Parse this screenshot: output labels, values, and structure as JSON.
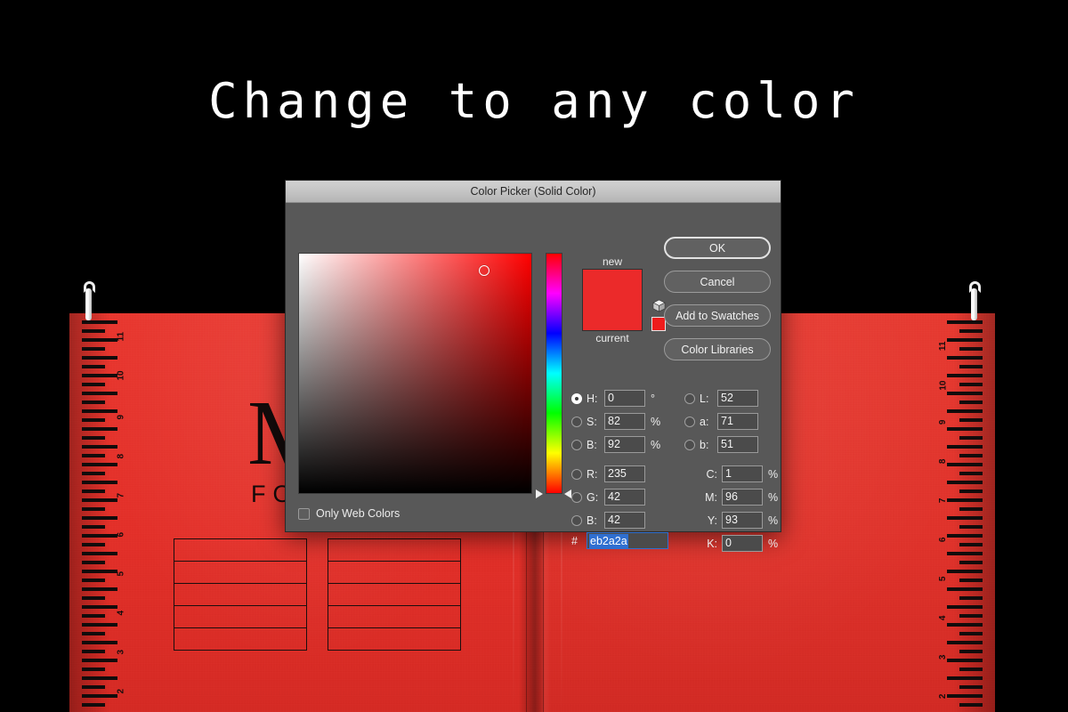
{
  "headline": "Change to any color",
  "notebook": {
    "brand_primary": "Mo",
    "brand_secondary": "FO",
    "cover_color": "#e8372f",
    "ruler_numbers_left": [
      "11",
      "10",
      "9",
      "8",
      "7",
      "6",
      "5",
      "4",
      "3",
      "2"
    ],
    "ruler_numbers_right": [
      "11",
      "10",
      "9",
      "8",
      "7",
      "6",
      "5",
      "4",
      "3",
      "2"
    ],
    "table_rows": 5
  },
  "dialog": {
    "title": "Color Picker (Solid Color)",
    "buttons": [
      {
        "label": "OK",
        "primary": true
      },
      {
        "label": "Cancel",
        "primary": false
      },
      {
        "label": "Add to Swatches",
        "primary": false
      },
      {
        "label": "Color Libraries",
        "primary": false
      }
    ],
    "preview": {
      "new_label": "new",
      "current_label": "current",
      "color": "#eb2a2a"
    },
    "gamut": {
      "cube_icon": "out-of-gamut-cube-icon",
      "websafe_chip_color": "#ee1c1c"
    },
    "only_web_colors": {
      "label": "Only Web Colors",
      "checked": false
    },
    "hsb": [
      {
        "key": "H",
        "label": "H:",
        "value": "0",
        "unit": "°",
        "selected": true
      },
      {
        "key": "S",
        "label": "S:",
        "value": "82",
        "unit": "%",
        "selected": false
      },
      {
        "key": "B",
        "label": "B:",
        "value": "92",
        "unit": "%",
        "selected": false
      }
    ],
    "lab": [
      {
        "key": "L",
        "label": "L:",
        "value": "52",
        "unit": "",
        "selected": false
      },
      {
        "key": "a",
        "label": "a:",
        "value": "71",
        "unit": "",
        "selected": false
      },
      {
        "key": "b",
        "label": "b:",
        "value": "51",
        "unit": "",
        "selected": false
      }
    ],
    "rgb": [
      {
        "key": "R",
        "label": "R:",
        "value": "235",
        "unit": "",
        "selected": false
      },
      {
        "key": "G",
        "label": "G:",
        "value": "42",
        "unit": "",
        "selected": false
      },
      {
        "key": "B",
        "label": "B:",
        "value": "42",
        "unit": "",
        "selected": false
      }
    ],
    "cmyk": [
      {
        "key": "C",
        "label": "C:",
        "value": "1",
        "unit": "%"
      },
      {
        "key": "M",
        "label": "M:",
        "value": "96",
        "unit": "%"
      },
      {
        "key": "Y",
        "label": "Y:",
        "value": "93",
        "unit": "%"
      },
      {
        "key": "K",
        "label": "K:",
        "value": "0",
        "unit": "%"
      }
    ],
    "hex": {
      "prefix": "#",
      "value": "eb2a2a",
      "selected": true
    },
    "field": {
      "cursor_x_pct": 79,
      "cursor_y_pct": 7,
      "hue": 0
    }
  }
}
